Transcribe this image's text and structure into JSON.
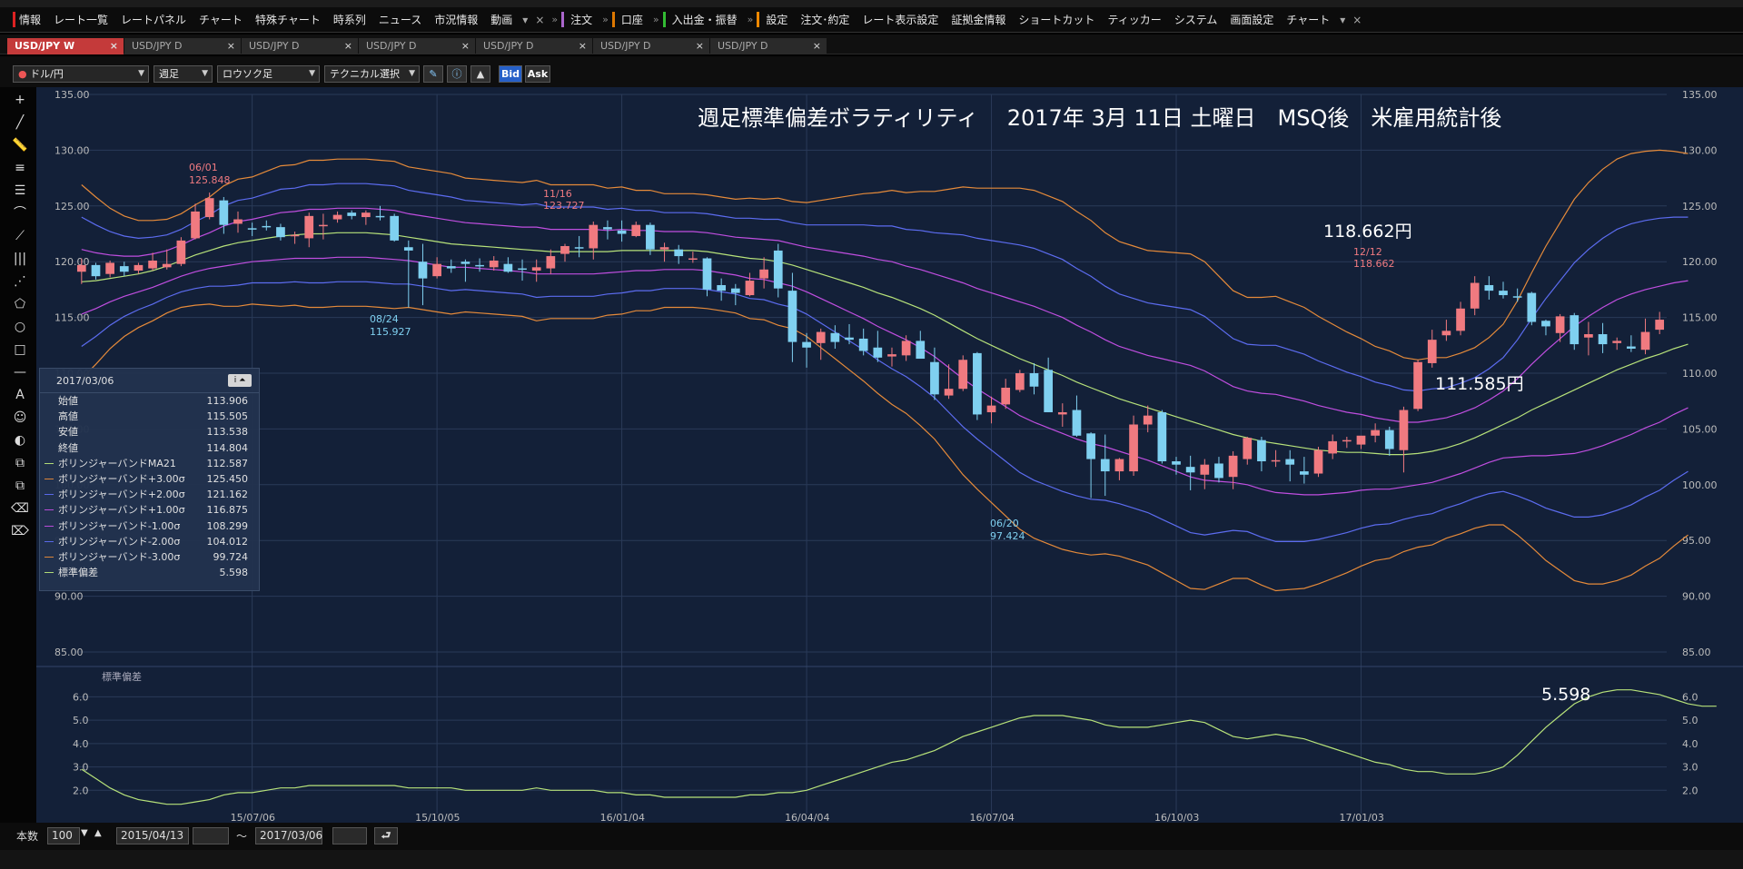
{
  "menu": {
    "items": [
      "情報",
      "レート一覧",
      "レートパネル",
      "チャート",
      "特殊チャート",
      "時系列",
      "ニュース",
      "市況情報",
      "動画"
    ],
    "order_label": "注文",
    "account_label": "口座",
    "deposit_label": "入出金・振替",
    "settings_items": [
      "設定",
      "注文･約定",
      "レート表示設定",
      "証拠金情報",
      "ショートカット",
      "ティッカー",
      "システム",
      "画面設定",
      "チャート"
    ]
  },
  "tabs": [
    {
      "label": "USD/JPY W",
      "active": true
    },
    {
      "label": "USD/JPY D",
      "active": false
    },
    {
      "label": "USD/JPY D",
      "active": false
    },
    {
      "label": "USD/JPY D",
      "active": false
    },
    {
      "label": "USD/JPY D",
      "active": false
    },
    {
      "label": "USD/JPY D",
      "active": false
    },
    {
      "label": "USD/JPY D",
      "active": false
    }
  ],
  "toolbar": {
    "pair": "ドル/円",
    "period": "週足",
    "chart_style": "ロウソク足",
    "technical": "テクニカル選択",
    "bid_label": "Bid",
    "ask_label": "Ask"
  },
  "chart_title": "週足標準偏差ボラティリティ　 2017年 3月 11日 土曜日　MSQ後　米雇用統計後",
  "annotations": {
    "high_price": "118.662円",
    "low_price": "111.585円",
    "stddev_value": "5.598",
    "marker_0601_date": "06/01",
    "marker_0601_value": "125.848",
    "marker_1116_date": "11/16",
    "marker_1116_value": "123.727",
    "marker_0824_date": "08/24",
    "marker_0824_value": "115.927",
    "marker_0620_date": "06/20",
    "marker_0620_value": "97.424",
    "marker_1212_date": "12/12",
    "marker_1212_value": "118.662"
  },
  "info_panel": {
    "date": "2017/03/06",
    "rows": [
      {
        "label": "始値",
        "value": "113.906",
        "color": ""
      },
      {
        "label": "高値",
        "value": "115.505",
        "color": ""
      },
      {
        "label": "安値",
        "value": "113.538",
        "color": ""
      },
      {
        "label": "終値",
        "value": "114.804",
        "color": ""
      },
      {
        "label": "ボリンジャーバンドMA21",
        "value": "112.587",
        "color": "#b7e27a"
      },
      {
        "label": "ボリンジャーバンド+3.00σ",
        "value": "125.450",
        "color": "#e58a3a"
      },
      {
        "label": "ボリンジャーバンド+2.00σ",
        "value": "121.162",
        "color": "#5c6cf0"
      },
      {
        "label": "ボリンジャーバンド+1.00σ",
        "value": "116.875",
        "color": "#c04ee0"
      },
      {
        "label": "ボリンジャーバンド-1.00σ",
        "value": "108.299",
        "color": "#c04ee0"
      },
      {
        "label": "ボリンジャーバンド-2.00σ",
        "value": "104.012",
        "color": "#5c6cf0"
      },
      {
        "label": "ボリンジャーバンド-3.00σ",
        "value": "99.724",
        "color": "#e58a3a"
      },
      {
        "label": "標準偏差",
        "value": "5.598",
        "color": "#b7e27a"
      }
    ]
  },
  "bottom": {
    "count_label": "本数",
    "count_value": "100",
    "start_date": "2015/04/13",
    "tilde": "～",
    "end_date": "2017/03/06"
  },
  "colors": {
    "bg": "#132038",
    "up": "#f07a80",
    "down": "#7fd0f0",
    "ma21": "#b7e27a",
    "sigma3": "#e58a3a",
    "sigma2": "#5c6cf0",
    "sigma1": "#c04ee0",
    "stddev": "#b7e27a"
  },
  "chart_data": {
    "type": "line",
    "price": {
      "yticks": [
        135.0,
        130.0,
        125.0,
        120.0,
        115.0,
        110.0,
        105.0,
        100.0,
        95.0,
        90.0,
        85.0
      ],
      "ylim": [
        85,
        135
      ],
      "xticks": [
        "15/07/06",
        "15/10/05",
        "16/01/04",
        "16/04/04",
        "16/07/04",
        "16/10/03",
        "17/01/03"
      ],
      "candles": [
        [
          119.1,
          120.3,
          118.0,
          119.7
        ],
        [
          119.7,
          119.9,
          118.4,
          118.7
        ],
        [
          118.9,
          120.1,
          118.6,
          119.9
        ],
        [
          119.6,
          120.0,
          118.7,
          119.1
        ],
        [
          119.2,
          119.9,
          118.9,
          119.7
        ],
        [
          119.4,
          120.8,
          119.2,
          120.1
        ],
        [
          119.5,
          121.1,
          119.3,
          119.8
        ],
        [
          119.8,
          122.2,
          119.6,
          121.9
        ],
        [
          122.1,
          125.2,
          122.0,
          124.5
        ],
        [
          124.0,
          126.2,
          123.8,
          125.7
        ],
        [
          125.5,
          125.8,
          122.5,
          123.3
        ],
        [
          123.4,
          124.5,
          122.6,
          123.8
        ],
        [
          123.0,
          123.5,
          122.3,
          122.9
        ],
        [
          123.2,
          123.7,
          122.8,
          123.1
        ],
        [
          123.1,
          123.4,
          121.9,
          122.2
        ],
        [
          122.3,
          122.7,
          121.6,
          122.4
        ],
        [
          122.1,
          124.4,
          121.3,
          124.1
        ],
        [
          123.2,
          124.3,
          122.0,
          123.3
        ],
        [
          123.8,
          124.5,
          123.5,
          124.2
        ],
        [
          124.4,
          124.6,
          123.8,
          124.1
        ],
        [
          124.0,
          124.6,
          123.3,
          124.4
        ],
        [
          124.1,
          125.0,
          123.7,
          124.0
        ],
        [
          124.1,
          124.3,
          121.8,
          121.9
        ],
        [
          121.3,
          121.9,
          115.9,
          121.0
        ],
        [
          120.0,
          121.6,
          116.1,
          118.5
        ],
        [
          118.7,
          120.4,
          118.5,
          119.8
        ],
        [
          119.6,
          120.2,
          119.0,
          119.4
        ],
        [
          120.0,
          120.2,
          118.2,
          119.8
        ],
        [
          119.7,
          120.3,
          119.1,
          119.6
        ],
        [
          119.5,
          120.5,
          119.2,
          120.1
        ],
        [
          119.8,
          120.4,
          119.0,
          119.1
        ],
        [
          119.4,
          120.2,
          118.3,
          119.3
        ],
        [
          119.2,
          120.2,
          118.2,
          119.5
        ],
        [
          119.4,
          121.1,
          118.9,
          120.5
        ],
        [
          120.7,
          121.6,
          120.0,
          121.4
        ],
        [
          121.3,
          122.3,
          120.4,
          121.2
        ],
        [
          121.2,
          123.6,
          120.2,
          123.3
        ],
        [
          123.1,
          123.7,
          122.0,
          122.9
        ],
        [
          122.8,
          123.7,
          121.8,
          122.5
        ],
        [
          122.3,
          123.6,
          122.2,
          123.3
        ],
        [
          123.3,
          123.5,
          120.6,
          121.1
        ],
        [
          121.1,
          121.7,
          120.0,
          121.3
        ],
        [
          121.1,
          121.5,
          119.8,
          120.5
        ],
        [
          120.3,
          120.9,
          119.9,
          120.3
        ],
        [
          120.3,
          120.4,
          116.9,
          117.5
        ],
        [
          117.9,
          118.5,
          116.5,
          117.4
        ],
        [
          117.6,
          118.0,
          116.1,
          117.2
        ],
        [
          117.0,
          119.0,
          116.9,
          118.3
        ],
        [
          118.5,
          120.4,
          117.6,
          119.3
        ],
        [
          121.0,
          121.6,
          116.8,
          117.6
        ],
        [
          117.4,
          119.0,
          111.0,
          112.8
        ],
        [
          112.8,
          113.6,
          110.5,
          112.3
        ],
        [
          112.7,
          114.0,
          111.2,
          113.7
        ],
        [
          113.6,
          114.3,
          112.2,
          112.8
        ],
        [
          113.2,
          114.4,
          112.6,
          113.0
        ],
        [
          113.1,
          114.0,
          111.6,
          112.0
        ],
        [
          112.3,
          113.8,
          111.0,
          111.4
        ],
        [
          111.5,
          112.3,
          110.6,
          111.7
        ],
        [
          111.6,
          113.4,
          111.1,
          112.9
        ],
        [
          112.9,
          113.8,
          111.4,
          111.3
        ],
        [
          111.0,
          112.3,
          107.6,
          108.1
        ],
        [
          108.0,
          110.8,
          107.7,
          108.6
        ],
        [
          108.6,
          111.6,
          108.4,
          111.2
        ],
        [
          111.8,
          111.9,
          105.8,
          106.3
        ],
        [
          106.5,
          107.9,
          105.5,
          107.1
        ],
        [
          107.2,
          109.5,
          106.8,
          108.7
        ],
        [
          108.5,
          110.3,
          108.3,
          110.0
        ],
        [
          110.0,
          110.9,
          108.1,
          108.8
        ],
        [
          110.3,
          111.4,
          106.5,
          106.5
        ],
        [
          106.3,
          107.3,
          105.2,
          106.5
        ],
        [
          106.7,
          108.0,
          104.3,
          104.4
        ],
        [
          104.6,
          104.7,
          98.8,
          102.3
        ],
        [
          102.3,
          104.5,
          99.0,
          101.2
        ],
        [
          101.2,
          102.4,
          100.4,
          102.3
        ],
        [
          101.2,
          106.2,
          100.8,
          105.4
        ],
        [
          105.4,
          107.1,
          104.7,
          106.2
        ],
        [
          106.5,
          106.7,
          101.9,
          102.1
        ],
        [
          102.1,
          102.5,
          100.9,
          101.8
        ],
        [
          101.6,
          102.6,
          99.5,
          101.1
        ],
        [
          100.9,
          102.3,
          99.6,
          101.8
        ],
        [
          101.9,
          102.5,
          100.2,
          100.6
        ],
        [
          100.7,
          103.0,
          99.6,
          102.6
        ],
        [
          102.3,
          104.3,
          101.8,
          104.2
        ],
        [
          104.0,
          104.3,
          101.2,
          102.1
        ],
        [
          102.1,
          103.1,
          101.6,
          102.2
        ],
        [
          102.3,
          103.1,
          100.3,
          101.8
        ],
        [
          101.2,
          102.5,
          100.1,
          100.9
        ],
        [
          101.0,
          103.4,
          100.7,
          103.1
        ],
        [
          102.8,
          104.5,
          102.3,
          103.9
        ],
        [
          103.9,
          104.3,
          103.3,
          104.0
        ],
        [
          103.6,
          104.1,
          103.2,
          104.4
        ],
        [
          104.4,
          105.5,
          103.8,
          104.9
        ],
        [
          104.9,
          105.2,
          102.6,
          103.2
        ],
        [
          103.1,
          107.0,
          101.1,
          106.7
        ],
        [
          106.8,
          111.2,
          106.6,
          111.0
        ],
        [
          110.9,
          113.9,
          110.5,
          113.0
        ],
        [
          113.4,
          114.8,
          112.9,
          113.8
        ],
        [
          113.8,
          116.4,
          113.4,
          115.8
        ],
        [
          115.8,
          118.7,
          115.2,
          118.1
        ],
        [
          117.9,
          118.7,
          116.6,
          117.4
        ],
        [
          117.4,
          118.2,
          116.7,
          117.0
        ],
        [
          116.9,
          117.6,
          116.4,
          116.8
        ],
        [
          117.2,
          117.3,
          114.3,
          114.6
        ],
        [
          114.7,
          114.8,
          113.4,
          114.2
        ],
        [
          113.6,
          115.3,
          112.8,
          115.1
        ],
        [
          115.2,
          115.4,
          112.1,
          112.6
        ],
        [
          113.2,
          114.6,
          111.6,
          113.5
        ],
        [
          113.5,
          114.5,
          111.8,
          112.6
        ],
        [
          112.7,
          113.2,
          112.1,
          112.9
        ],
        [
          112.4,
          113.4,
          111.9,
          112.2
        ],
        [
          112.1,
          114.9,
          111.7,
          113.7
        ],
        [
          113.9,
          115.5,
          113.5,
          114.8
        ]
      ],
      "ma21": [
        118.2,
        118.3,
        118.5,
        118.7,
        118.9,
        119.2,
        119.6,
        120.1,
        120.6,
        121.0,
        121.4,
        121.7,
        121.9,
        122.1,
        122.3,
        122.4,
        122.5,
        122.5,
        122.6,
        122.6,
        122.6,
        122.5,
        122.4,
        122.2,
        122.0,
        121.8,
        121.6,
        121.5,
        121.4,
        121.3,
        121.2,
        121.1,
        121.0,
        120.9,
        120.9,
        120.9,
        120.9,
        120.9,
        121.0,
        121.0,
        121.0,
        121.0,
        121.0,
        121.0,
        120.9,
        120.7,
        120.5,
        120.3,
        120.2,
        120.0,
        119.7,
        119.3,
        118.9,
        118.5,
        118.1,
        117.7,
        117.2,
        116.8,
        116.3,
        115.8,
        115.2,
        114.5,
        113.8,
        113.1,
        112.5,
        111.9,
        111.3,
        110.8,
        110.3,
        109.8,
        109.2,
        108.7,
        108.2,
        107.7,
        107.3,
        106.9,
        106.5,
        106.1,
        105.7,
        105.3,
        104.9,
        104.5,
        104.2,
        103.9,
        103.7,
        103.5,
        103.3,
        103.1,
        103.0,
        102.9,
        102.9,
        102.8,
        102.7,
        102.7,
        102.8,
        103.0,
        103.3,
        103.7,
        104.2,
        104.8,
        105.4,
        106.0,
        106.7,
        107.3,
        107.9,
        108.5,
        109.1,
        109.7,
        110.3,
        110.8,
        111.3,
        111.7,
        112.2,
        112.6
      ],
      "stddev": [
        2.9,
        2.5,
        2.1,
        1.8,
        1.6,
        1.5,
        1.4,
        1.4,
        1.5,
        1.6,
        1.8,
        1.9,
        1.9,
        2.0,
        2.1,
        2.1,
        2.2,
        2.2,
        2.2,
        2.2,
        2.2,
        2.2,
        2.2,
        2.1,
        2.1,
        2.1,
        2.1,
        2.0,
        2.0,
        2.0,
        2.0,
        2.0,
        2.1,
        2.0,
        2.0,
        2.0,
        2.0,
        1.9,
        1.9,
        1.8,
        1.8,
        1.7,
        1.7,
        1.7,
        1.7,
        1.7,
        1.7,
        1.8,
        1.8,
        1.9,
        1.9,
        2.0,
        2.2,
        2.4,
        2.6,
        2.8,
        3.0,
        3.2,
        3.3,
        3.5,
        3.7,
        4.0,
        4.3,
        4.5,
        4.7,
        4.9,
        5.1,
        5.2,
        5.2,
        5.2,
        5.1,
        5.0,
        4.8,
        4.7,
        4.7,
        4.7,
        4.8,
        4.9,
        5.0,
        4.9,
        4.6,
        4.3,
        4.2,
        4.3,
        4.4,
        4.3,
        4.2,
        4.0,
        3.8,
        3.6,
        3.4,
        3.2,
        3.1,
        2.9,
        2.8,
        2.8,
        2.7,
        2.7,
        2.7,
        2.8,
        3.0,
        3.5,
        4.1,
        4.7,
        5.2,
        5.7,
        6.0,
        6.2,
        6.3,
        6.3,
        6.2,
        6.1,
        5.9,
        5.7,
        5.6,
        5.6
      ]
    },
    "stddev_panel": {
      "title": "標準偏差",
      "yticks": [
        6.0,
        5.0,
        4.0,
        3.0,
        2.0
      ],
      "ylim": [
        1.0,
        6.6
      ]
    }
  }
}
